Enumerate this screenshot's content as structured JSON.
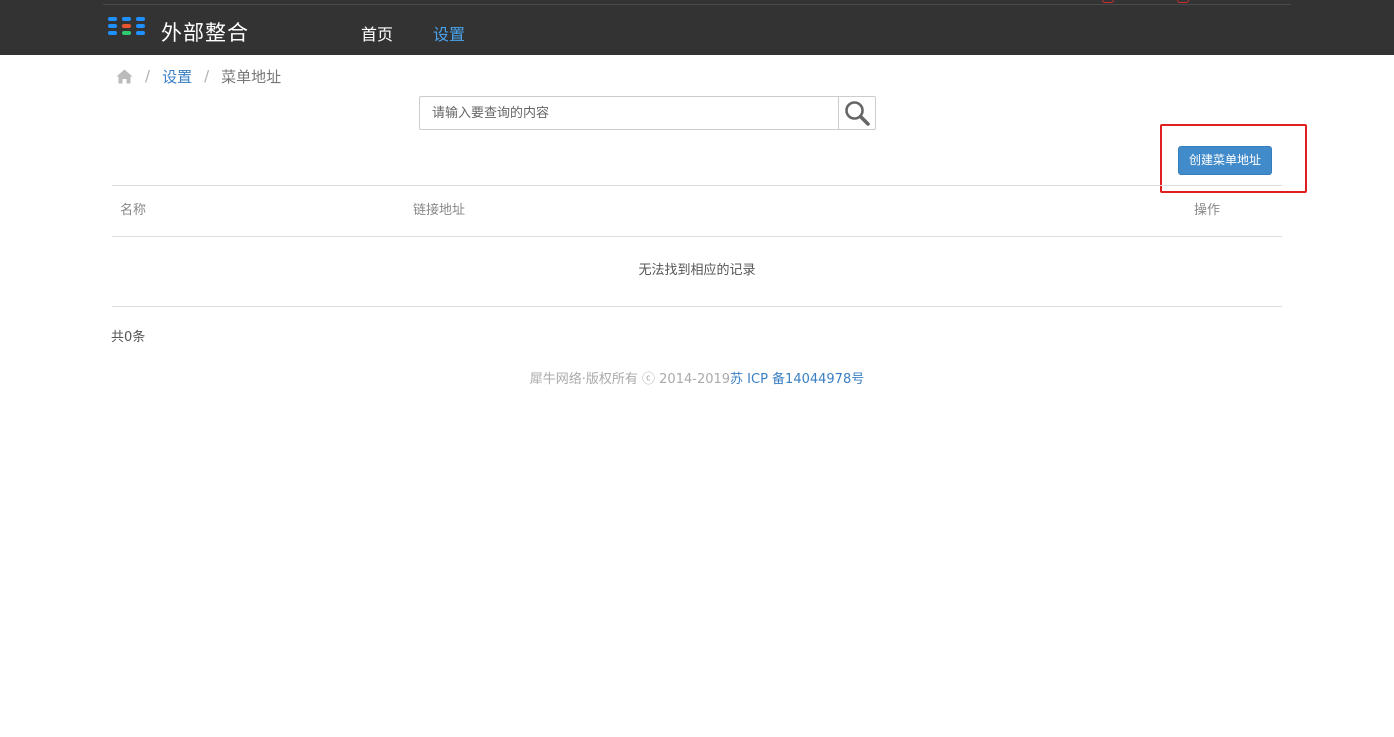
{
  "header": {
    "brand": "外部整合",
    "nav": [
      {
        "label": "首页",
        "active": false
      },
      {
        "label": "设置",
        "active": true
      }
    ],
    "logo_colors": [
      "#1e90ff",
      "#e8542f",
      "#2ecc71"
    ]
  },
  "breadcrumb": {
    "home_icon": "home-icon",
    "items": [
      "设置",
      "菜单地址"
    ]
  },
  "search": {
    "placeholder": "请输入要查询的内容",
    "value": "",
    "icon": "search-icon"
  },
  "toolbar": {
    "create_label": "创建菜单地址"
  },
  "table": {
    "columns": [
      "名称",
      "链接地址",
      "操作"
    ],
    "rows": [],
    "empty_text": "无法找到相应的记录"
  },
  "pagination": {
    "total_text": "共0条"
  },
  "footer": {
    "copyright": "犀牛网络·版权所有 ⓒ 2014-2019",
    "icp": "苏 ICP 备14044978号"
  },
  "colors": {
    "topbar": "#333333",
    "active_nav": "#4aa3ee",
    "link": "#3a7fc4",
    "primary_button": "#428bca",
    "highlight": "#e02020"
  }
}
